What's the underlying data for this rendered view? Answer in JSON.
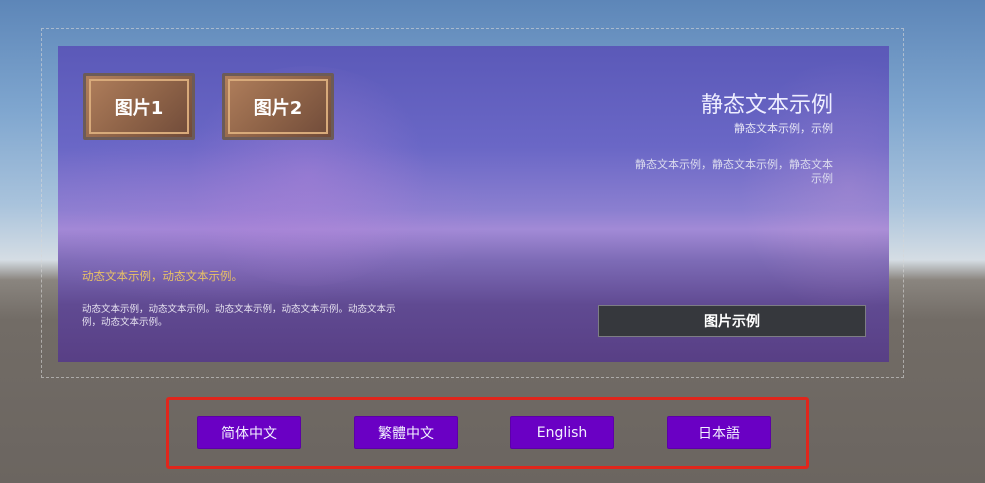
{
  "panel": {
    "picture_buttons": [
      {
        "label": "图片1"
      },
      {
        "label": "图片2"
      }
    ],
    "static_title": "静态文本示例",
    "static_subtitle": "静态文本示例，示例",
    "static_paragraph": "静态文本示例，静态文本示例，静态文本示例",
    "dynamic_gold": "动态文本示例，动态文本示例。",
    "dynamic_paragraph": "动态文本示例，动态文本示例。动态文本示例，动态文本示例。动态文本示例，动态文本示例。",
    "image_example_button": "图片示例"
  },
  "language_bar": {
    "buttons": [
      {
        "label": "简体中文"
      },
      {
        "label": "繁體中文"
      },
      {
        "label": "English"
      },
      {
        "label": "日本語"
      }
    ],
    "highlight_color": "#e0261c",
    "button_color": "#6a00c4"
  }
}
